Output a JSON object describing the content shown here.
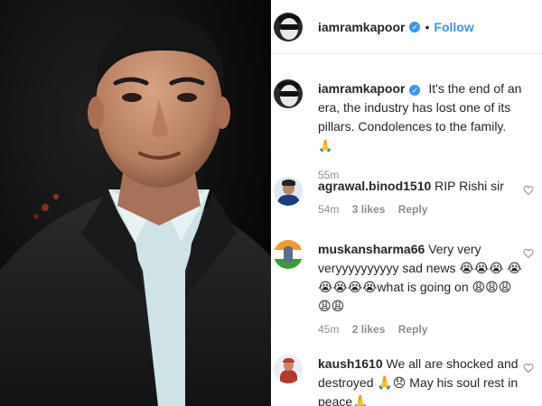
{
  "header": {
    "username": "iamramkapoor",
    "separator": "•",
    "follow_label": "Follow",
    "verified_mark": "✓"
  },
  "caption": {
    "username": "iamramkapoor",
    "text": "It's the end of an era, the industry has lost one of its pillars. Condolences to the family.",
    "emoji": "🙏",
    "time": "55m"
  },
  "comments": [
    {
      "username": "agrawal.binod1510",
      "text": "RIP Rishi sir",
      "time": "54m",
      "likes": "3 likes",
      "reply": "Reply"
    },
    {
      "username": "muskansharma66",
      "text": "Very very veryyyyyyyyyy sad news 😭😭😭 😭😭😭😭😭what is going on 😩😩😩😩😩",
      "time": "45m",
      "likes": "2 likes",
      "reply": "Reply"
    },
    {
      "username": "kaush1610",
      "text": "We all are shocked and destroyed 🙏😞 May his soul rest in peace🙏",
      "time": "",
      "likes": "",
      "reply": ""
    }
  ],
  "icons": {
    "verified": "verified-badge-icon",
    "like": "heart-icon"
  },
  "colors": {
    "accent": "#3897f0",
    "secondary_text": "#8e8e8e",
    "primary_text": "#262626"
  }
}
